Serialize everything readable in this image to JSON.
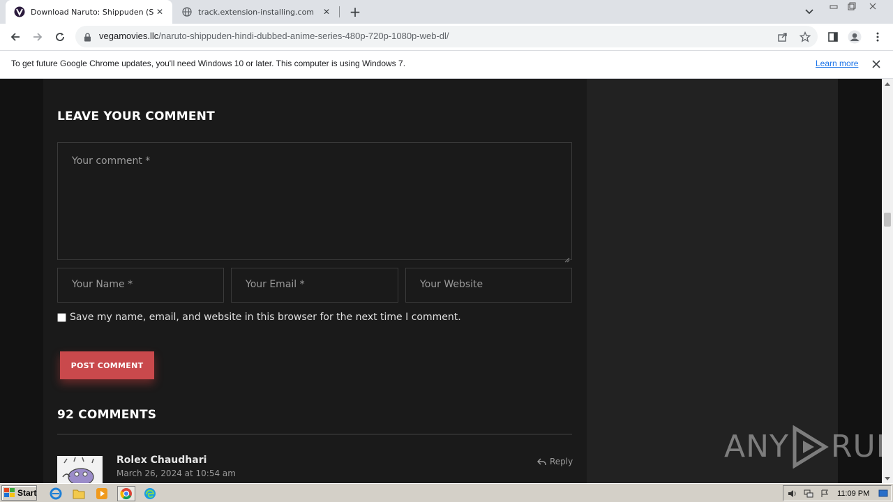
{
  "browser": {
    "tabs": [
      {
        "title": "Download Naruto: Shippuden (Seaso",
        "active": true,
        "favicon": "vegamovies-v-icon"
      },
      {
        "title": "track.extension-installing.com",
        "active": false,
        "favicon": "globe-icon"
      }
    ],
    "address": {
      "domain": "vegamovies.llc",
      "path": "/naruto-shippuden-hindi-dubbed-anime-series-480p-720p-1080p-web-dl/"
    },
    "infobar": {
      "message": "To get future Google Chrome updates, you'll need Windows 10 or later. This computer is using Windows 7.",
      "link": "Learn more"
    }
  },
  "page": {
    "comment_form": {
      "heading": "LEAVE YOUR COMMENT",
      "comment_placeholder": "Your comment *",
      "name_placeholder": "Your Name *",
      "email_placeholder": "Your Email *",
      "website_placeholder": "Your Website",
      "save_label": "Save my name, email, and website in this browser for the next time I comment.",
      "submit_label": "POST COMMENT"
    },
    "comments": {
      "heading": "92 COMMENTS",
      "items": [
        {
          "author": "Rolex Chaudhari",
          "date": "March 26, 2024 at 10:54 am",
          "reply_label": "Reply"
        }
      ]
    },
    "watermark": {
      "left": "ANY",
      "right": "RUN"
    }
  },
  "taskbar": {
    "start_label": "Start",
    "clock": "11:09 PM"
  },
  "colors": {
    "accent_button": "#c9494c",
    "page_bg": "#121212",
    "content_bg": "#1a1a1a",
    "sidebar_bg": "#222222",
    "link": "#1a73e8"
  }
}
